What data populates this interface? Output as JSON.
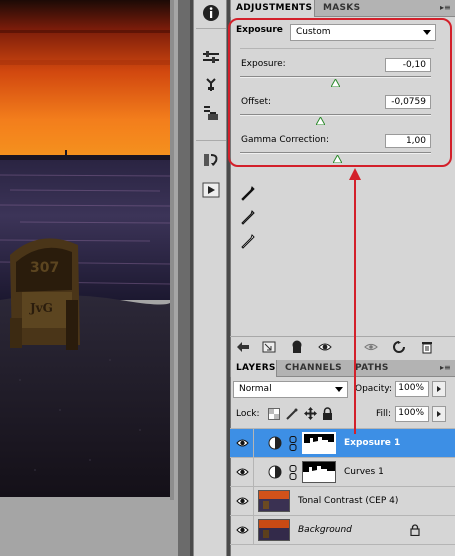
{
  "adjustments_panel": {
    "tabs": [
      "ADJUSTMENTS",
      "MASKS"
    ],
    "title": "Exposure",
    "preset": "Custom",
    "controls": [
      {
        "label": "Exposure:",
        "value": "-0,10",
        "slider": 0.5
      },
      {
        "label": "Offset:",
        "value": "-0,0759",
        "slider": 0.42
      },
      {
        "label": "Gamma Correction:",
        "value": "1,00",
        "slider": 0.51
      }
    ]
  },
  "layers_panel": {
    "tabs": [
      "LAYERS",
      "CHANNELS",
      "PATHS"
    ],
    "blend_mode": "Normal",
    "opacity_label": "Opacity:",
    "opacity_value": "100%",
    "lock_label": "Lock:",
    "fill_label": "Fill:",
    "fill_value": "100%",
    "layers": [
      {
        "name": "Exposure 1",
        "type": "adjustment",
        "selected": true
      },
      {
        "name": "Curves 1",
        "type": "adjustment",
        "selected": false
      },
      {
        "name": "Tonal Contrast (CEP 4)",
        "type": "image",
        "selected": false
      },
      {
        "name": "Background",
        "type": "image",
        "selected": false,
        "locked": true
      }
    ]
  },
  "colors": {
    "highlight_outline": "#d3202a",
    "selected_layer": "#3d8fe5"
  },
  "icons": {
    "tool_strip": [
      "info-icon",
      "levels-icon",
      "brightness-icon",
      "channel-mixer-icon",
      "history-icon",
      "actions-icon"
    ],
    "eyedroppers": [
      "black-point-eyedropper-icon",
      "gray-point-eyedropper-icon",
      "white-point-eyedropper-icon"
    ],
    "adjustment_footer": [
      "back-icon",
      "expanded-view-icon",
      "clip-to-layer-icon",
      "visibility-icon",
      "view-previous-icon",
      "reset-icon",
      "delete-icon"
    ]
  }
}
